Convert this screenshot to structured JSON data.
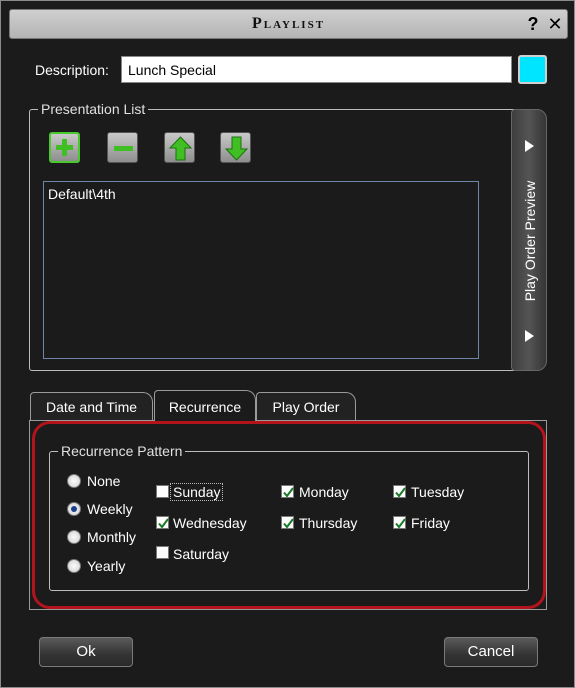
{
  "window": {
    "title": "Playlist",
    "help_glyph": "?",
    "close_glyph": "✕"
  },
  "description": {
    "label": "Description:",
    "value": "Lunch Special",
    "color": "#00e5ff"
  },
  "presentation_list": {
    "label": "Presentation List",
    "toolbar_icons": [
      "add-icon",
      "remove-icon",
      "move-up-icon",
      "move-down-icon"
    ],
    "items": [
      "Default\\4th"
    ],
    "preview_tab_label": "Play Order Preview"
  },
  "tabs": [
    {
      "label": "Date and Time",
      "selected": false
    },
    {
      "label": "Recurrence",
      "selected": true
    },
    {
      "label": "Play Order",
      "selected": false
    }
  ],
  "recurrence": {
    "group_label": "Recurrence Pattern",
    "patterns": [
      {
        "label": "None",
        "selected": false
      },
      {
        "label": "Weekly",
        "selected": true
      },
      {
        "label": "Monthly",
        "selected": false
      },
      {
        "label": "Yearly",
        "selected": false
      }
    ],
    "days": [
      {
        "label": "Sunday",
        "checked": false
      },
      {
        "label": "Monday",
        "checked": true
      },
      {
        "label": "Tuesday",
        "checked": true
      },
      {
        "label": "Wednesday",
        "checked": true
      },
      {
        "label": "Thursday",
        "checked": true
      },
      {
        "label": "Friday",
        "checked": true
      },
      {
        "label": "Saturday",
        "checked": false
      }
    ],
    "highlight_color": "#b3141c"
  },
  "buttons": {
    "ok": "Ok",
    "cancel": "Cancel"
  }
}
